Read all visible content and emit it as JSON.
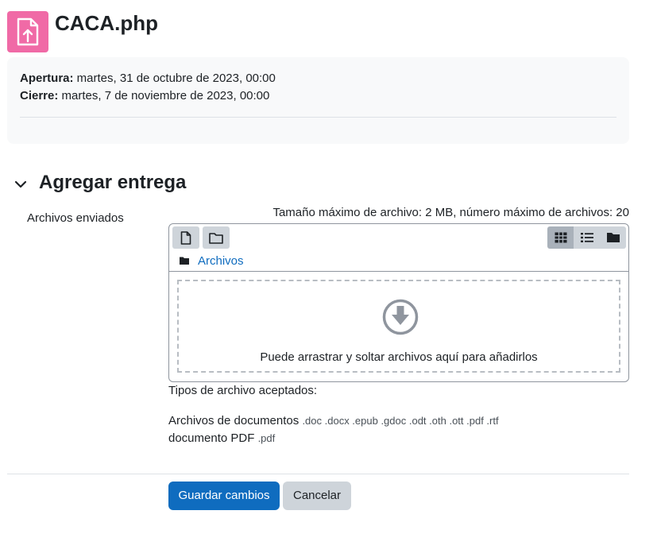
{
  "header": {
    "title": "CACA.php",
    "icon": "file-upload-icon",
    "icon_color": "#f06aa6"
  },
  "dates": {
    "open_label": "Apertura:",
    "open_value": " martes, 31 de octubre de 2023, 00:00",
    "close_label": "Cierre:",
    "close_value": " martes, 7 de noviembre de 2023, 00:00"
  },
  "section": {
    "title": "Agregar entrega",
    "icon": "chevron-down-icon"
  },
  "field": {
    "label": "Archivos enviados",
    "max_info": "Tamaño máximo de archivo: 2 MB, número máximo de archivos: 20"
  },
  "filepicker": {
    "toolbar": [
      "add-file-icon",
      "create-folder-icon"
    ],
    "views": [
      "grid-view-icon",
      "list-view-icon",
      "folder-view-icon"
    ],
    "active_view": "grid-view-icon",
    "path": "Archivos",
    "drop_text": "Puede arrastrar y soltar archivos aquí para añadirlos"
  },
  "accepted": {
    "title": "Tipos de archivo aceptados:",
    "types": [
      {
        "name": "Archivos de documentos",
        "exts": ".doc .docx .epub .gdoc .odt .oth .ott .pdf .rtf"
      },
      {
        "name": "documento PDF",
        "exts": ".pdf"
      }
    ]
  },
  "buttons": {
    "save": "Guardar cambios",
    "cancel": "Cancelar"
  },
  "colors": {
    "primary": "#0f6cbf",
    "link": "#0f6cbf",
    "secondary": "#ced4da"
  }
}
